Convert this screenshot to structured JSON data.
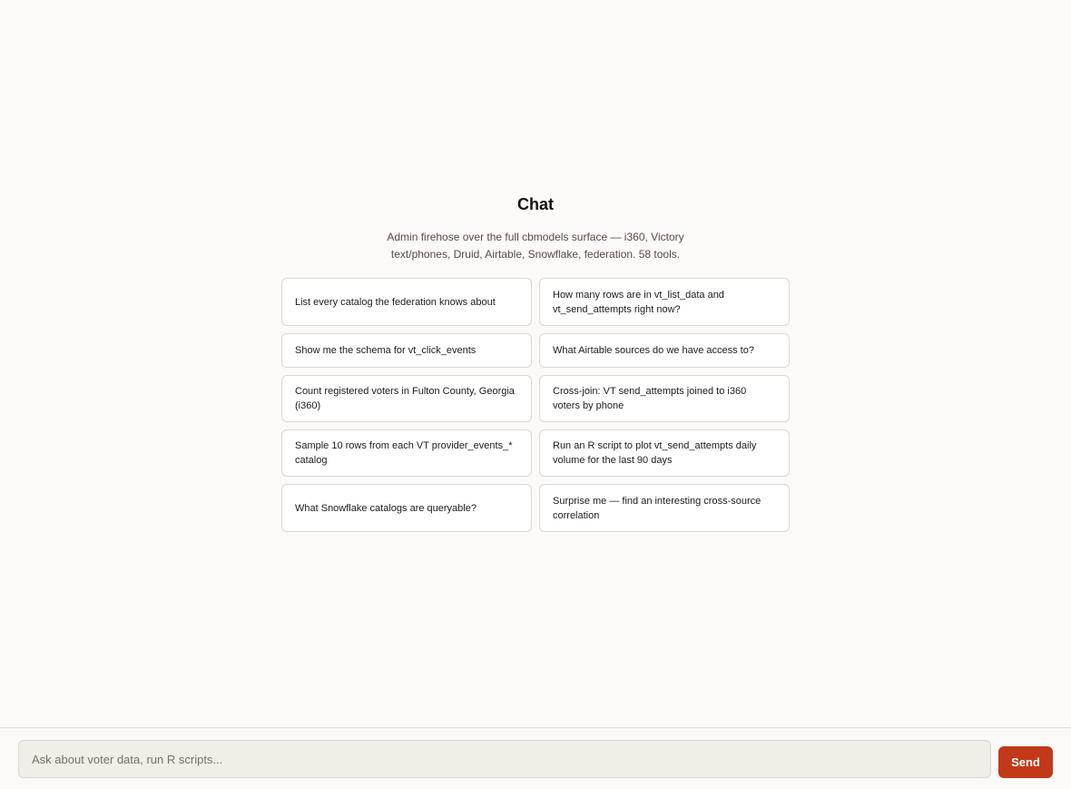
{
  "page": {
    "title": "Chat",
    "subtitle_line1": "Admin firehose over the full cbmodels surface — i360, Victory",
    "subtitle_line2": "text/phones, Druid, Airtable, Snowflake, federation. 58 tools."
  },
  "suggestions": [
    "List every catalog the federation knows about",
    "How many rows are in vt_list_data and vt_send_attempts right now?",
    "Show me the schema for vt_click_events",
    "What Airtable sources do we have access to?",
    "Count registered voters in Fulton County, Georgia (i360)",
    "Cross-join: VT send_attempts joined to i360 voters by phone",
    "Sample 10 rows from each VT provider_events_* catalog",
    "Run an R script to plot vt_send_attempts daily volume for the last 90 days",
    "What Snowflake catalogs are queryable?",
    "Surprise me — find an interesting cross-source correlation"
  ],
  "composer": {
    "placeholder": "Ask about voter data, run R scripts...",
    "value": "",
    "send_label": "Send"
  },
  "colors": {
    "background": "#fbfaf8",
    "accent": "#c2391a",
    "card_border": "#dcd8d3",
    "input_background": "#f1ede7"
  }
}
